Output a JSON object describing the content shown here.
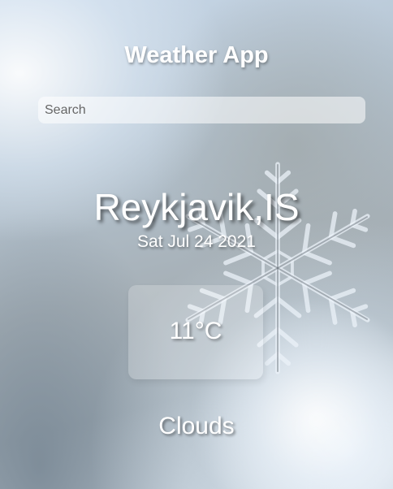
{
  "app": {
    "title": "Weather App"
  },
  "search": {
    "placeholder": "Search",
    "value": ""
  },
  "weather": {
    "location": "Reykjavik,IS",
    "date": "Sat Jul 24 2021",
    "temperature": "11°C",
    "condition": "Clouds"
  },
  "colors": {
    "text": "#ffffff"
  }
}
